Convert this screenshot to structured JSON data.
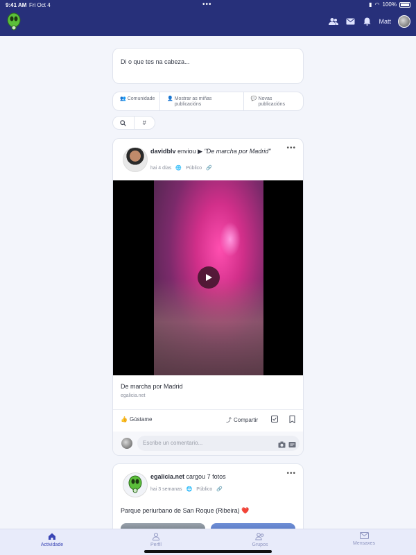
{
  "statusbar": {
    "time": "9:41 AM",
    "date": "Fri Oct 4",
    "battery": "100%"
  },
  "header": {
    "user_name": "Matt",
    "icons": [
      "people-icon",
      "mail-icon",
      "bell-icon"
    ]
  },
  "compose": {
    "placeholder": "Di o que tes na cabeza..."
  },
  "filters": {
    "community": "Comunidade",
    "my_posts": "Mostrar as miñas publicacións",
    "new_posts": "Novas publicacións"
  },
  "search": {
    "hashtag": "#"
  },
  "post1": {
    "author": "davidblv",
    "verb": "enviou",
    "title": "\"De marcha por Madrid\"",
    "time": "hai 4 días",
    "visibility": "Público",
    "caption": "De marcha por Madrid",
    "source": "egalicia.net",
    "like_label": "Gústame",
    "share_label": "Compartir",
    "comment_placeholder": "Escribe un comentario..."
  },
  "post2": {
    "author": "egalicia.net",
    "verb": "cargou 7 fotos",
    "time": "hai 3 semanas",
    "visibility": "Público",
    "caption": "Parque periurbano de San Roque (Ribeira) ❤️"
  },
  "bottom_nav": [
    {
      "label": "Actividade",
      "active": true
    },
    {
      "label": "Perfil",
      "active": false
    },
    {
      "label": "Grupos",
      "active": false
    },
    {
      "label": "Mensaxes",
      "active": false
    }
  ],
  "colors": {
    "header_bg": "#27307a",
    "accent": "#3a45b5",
    "page_bg": "#f3f5fb"
  }
}
